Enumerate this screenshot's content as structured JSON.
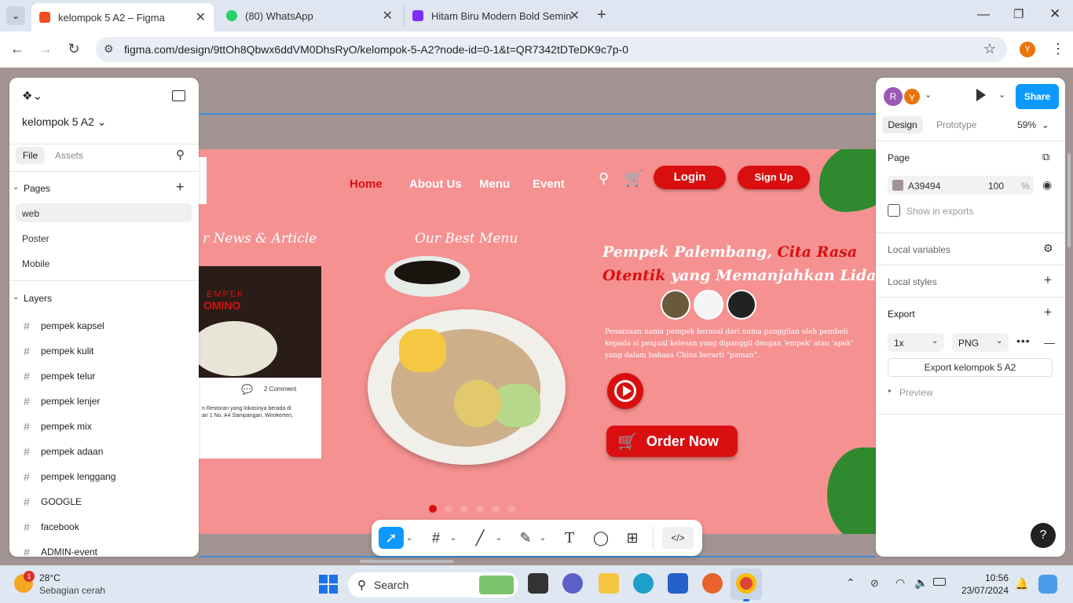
{
  "browser": {
    "tabs": [
      {
        "title": "kelompok 5 A2 – Figma",
        "color": "#f24e1e"
      },
      {
        "title": "(80) WhatsApp",
        "color": "#25d366"
      },
      {
        "title": "Hitam Biru Modern Bold Semin",
        "color": "#7b2ff7"
      }
    ],
    "new_tab": "+",
    "url": "figma.com/design/9ttOh8Qbwx6ddVM0DhsRyO/kelompok-5-A2?node-id=0-1&t=QR7342tDTeDK9c7p-0",
    "profile_initial": "Y"
  },
  "left": {
    "file_name": "kelompok 5 A2",
    "tabs": {
      "file": "File",
      "assets": "Assets"
    },
    "pages_label": "Pages",
    "pages": [
      "web",
      "Poster",
      "Mobile"
    ],
    "layers_label": "Layers",
    "layers": [
      "pempek kapsel",
      "pempek kulit",
      "pempek telur",
      "pempek lenjer",
      "pempek mix",
      "pempek adaan",
      "pempek lenggang",
      "GOOGLE",
      "facebook",
      "ADMIN-event"
    ]
  },
  "right": {
    "avatars": [
      "R",
      "Y"
    ],
    "share": "Share",
    "tabs": {
      "design": "Design",
      "prototype": "Prototype"
    },
    "zoom": "59%",
    "page_label": "Page",
    "fill_hex": "A39494",
    "fill_opacity": "100",
    "percent": "%",
    "show_in_exports": "Show in exports",
    "local_variables": "Local variables",
    "local_styles": "Local styles",
    "export_label": "Export",
    "export_scale": "1x",
    "export_format": "PNG",
    "export_button": "Export kelompok 5 A2",
    "preview": "Preview",
    "help": "?"
  },
  "design": {
    "nav": {
      "home": "Home",
      "about": "About Us",
      "menu": "Menu",
      "event": "Event",
      "login": "Login",
      "signup": "Sign Up"
    },
    "news_heading": "r News & Article",
    "news_card_brand_1": "EMPEK",
    "news_card_brand_2": "OMINO",
    "comment_count": "2 Comment",
    "news_text_1": "n Restoran yang lokasinya berada di",
    "news_text_2": "an 1 No. A4 Sampangan, Wirokerten,",
    "best_menu": "Our Best Menu",
    "headline_1a": "Pempek Palembang, ",
    "headline_1b": "Cita Rasa",
    "headline_2a": "Otentik",
    "headline_2b": " yang Memanjahkan Lidah",
    "paragraph_1": "Penamaan nama pempek berasal dari nama panggilan oleh pembeli",
    "paragraph_2": "kepada si penjual kelesan yang dipanggil dengan 'empek' atau 'apek'",
    "paragraph_3": "yang dalam bahasa China berarti \"paman\".",
    "order_now": "Order Now",
    "carousel_dots": 6,
    "colors": {
      "background": "#f69191",
      "red": "#d90f0f",
      "accent_red": "#e8262a"
    }
  },
  "toolbar": {
    "code": "</>"
  },
  "taskbar": {
    "weather_temp": "28°C",
    "weather_desc": "Sebagian cerah",
    "weather_badge": "1",
    "search": "Search",
    "time": "10:56",
    "date": "23/07/2024"
  }
}
